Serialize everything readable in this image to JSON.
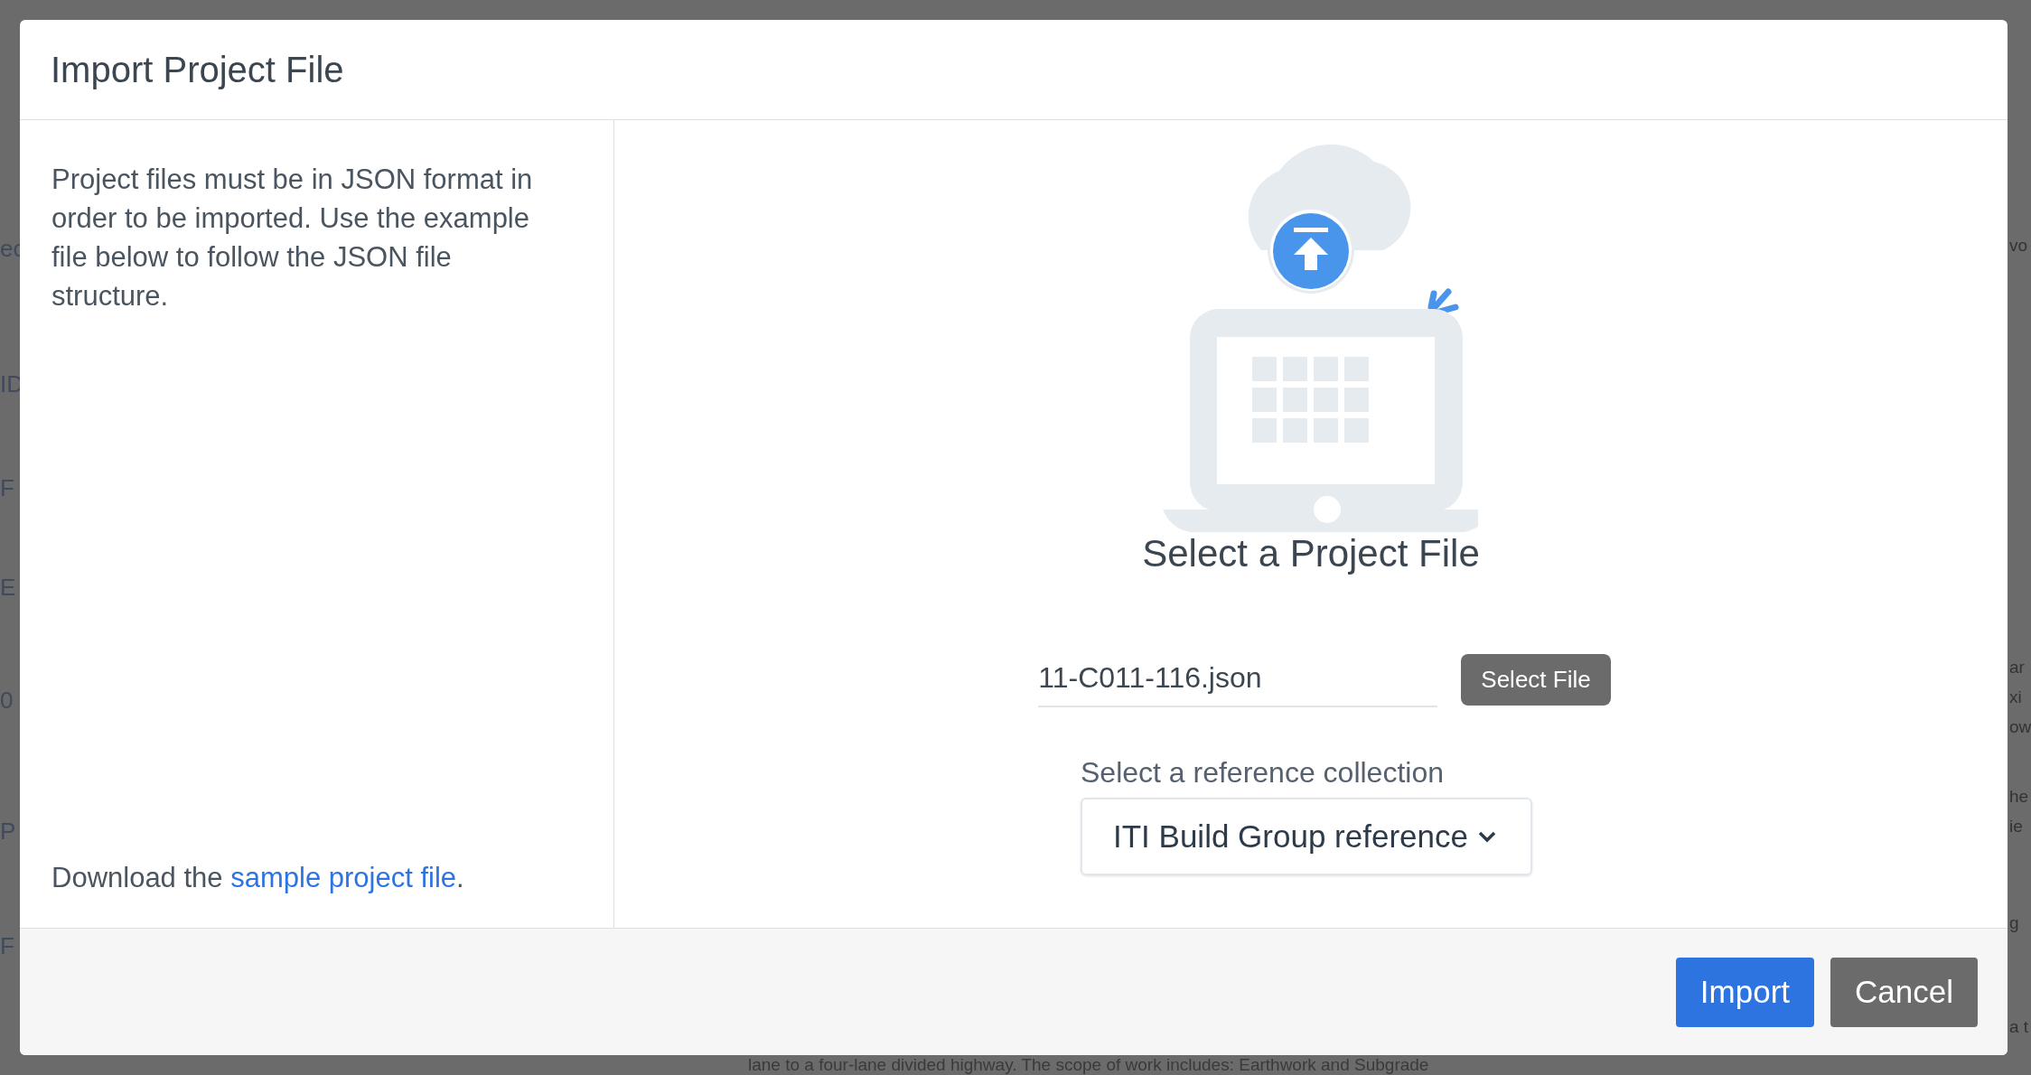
{
  "background_page": {
    "left_fragments": [
      "ec",
      "ID",
      "F",
      "E",
      "0",
      "P",
      "F"
    ],
    "right_fragments": [
      "vo",
      "ar",
      "xi",
      "ow",
      "he",
      "ie",
      "g",
      "a t"
    ],
    "bottom_text": "lane to a four-lane divided highway. The scope of work includes: Earthwork and Subgrade"
  },
  "dialog": {
    "title": "Import Project File",
    "description": "Project files must be in JSON format in order to be imported. Use the example file below to follow the JSON file structure.",
    "download_prefix": "Download the ",
    "download_link": "sample project file",
    "download_suffix": ".",
    "upload_heading": "Select a Project File",
    "file_field": {
      "value": "11-C011-116.json"
    },
    "select_file_button": "Select File",
    "reference_label": "Select a reference collection",
    "reference_dropdown": {
      "value": "ITI Build Group reference"
    },
    "buttons": [
      {
        "label": "Import",
        "kind": "primary"
      },
      {
        "label": "Cancel",
        "kind": "secondary"
      }
    ]
  }
}
